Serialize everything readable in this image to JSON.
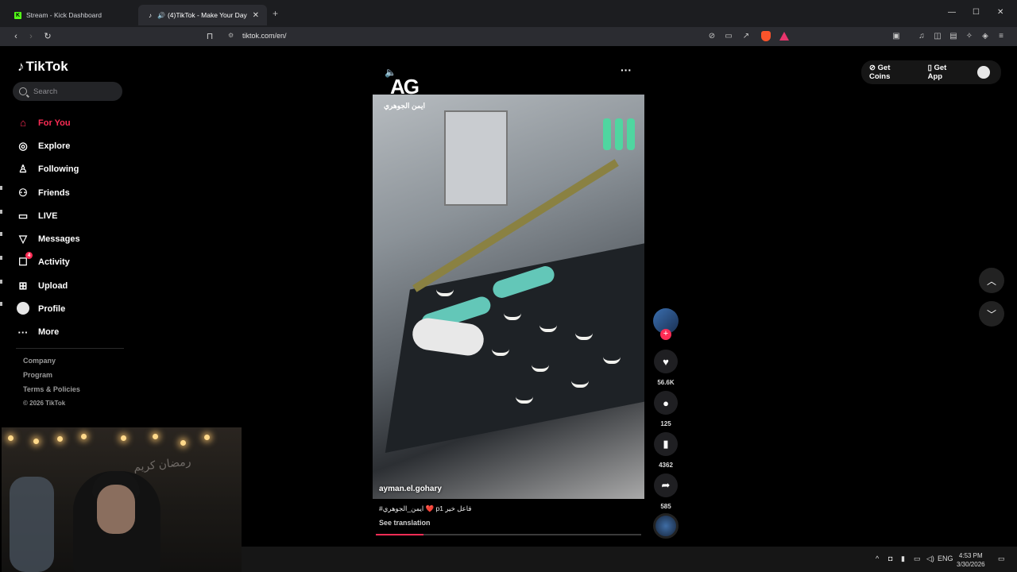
{
  "browser": {
    "tabs": [
      {
        "title": "Stream - Kick Dashboard",
        "favicon": "K"
      },
      {
        "title": "(4)TikTok - Make Your Day",
        "favicon": "tiktok-icon"
      }
    ],
    "url": "tiktok.com/en/"
  },
  "sidebar": {
    "brand": "TikTok",
    "search_placeholder": "Search",
    "items": [
      {
        "label": "For You",
        "icon": "home-icon"
      },
      {
        "label": "Explore",
        "icon": "compass-icon"
      },
      {
        "label": "Following",
        "icon": "following-icon"
      },
      {
        "label": "Friends",
        "icon": "friends-icon"
      },
      {
        "label": "LIVE",
        "icon": "live-icon"
      },
      {
        "label": "Messages",
        "icon": "messages-icon"
      },
      {
        "label": "Activity",
        "icon": "activity-icon",
        "badge": "4"
      },
      {
        "label": "Upload",
        "icon": "upload-icon"
      },
      {
        "label": "Profile",
        "icon": "profile-icon"
      },
      {
        "label": "More",
        "icon": "more-icon"
      }
    ],
    "footer": {
      "company": "Company",
      "program": "Program",
      "terms": "Terms & Policies",
      "copyright": "© 2026 TikTok"
    }
  },
  "webcam": {
    "sign_text": "رمضان كريم"
  },
  "video": {
    "overlay_logo": "AG",
    "overlay_name": "ايمن الجوهري",
    "username": "ayman.el.gohary",
    "caption": "#ايمن_الجوهري ❤️ p1 فاعل خير",
    "see_translation": "See translation",
    "progress": 0.18,
    "stats": {
      "likes": "56.6K",
      "comments": "125",
      "saves": "4362",
      "shares": "585"
    }
  },
  "header": {
    "get_coins": "Get Coins",
    "get_app": "Get App"
  },
  "taskbar": {
    "lang": "ENG",
    "time": "4:53 PM",
    "date": "3/30/2026"
  },
  "colors": {
    "accent": "#fe2c55",
    "background": "#000000"
  }
}
